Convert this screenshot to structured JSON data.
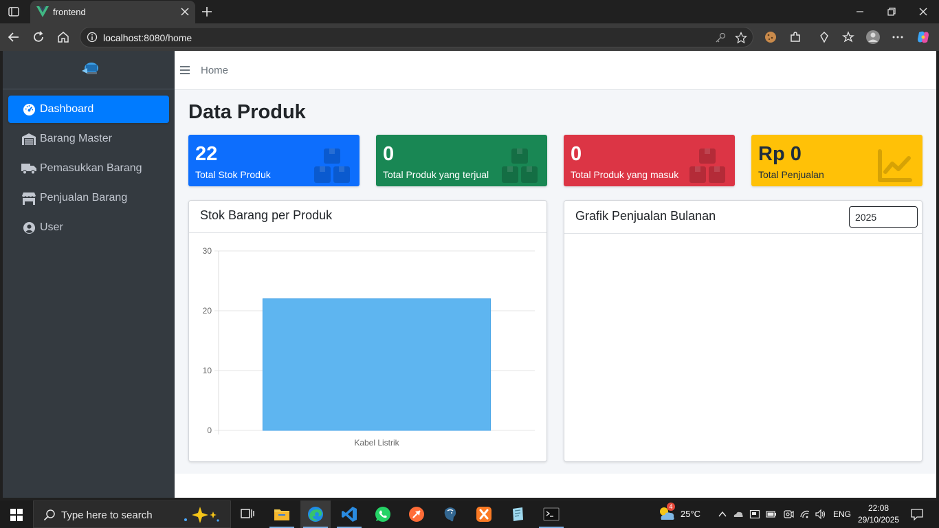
{
  "browser": {
    "tab_title": "frontend",
    "url_host": "localhost",
    "url_rest": ":8080/home"
  },
  "sidebar": {
    "items": [
      {
        "label": "Dashboard",
        "icon": "tachometer-icon",
        "active": true
      },
      {
        "label": "Barang Master",
        "icon": "warehouse-icon"
      },
      {
        "label": "Pemasukkan Barang",
        "icon": "truck-icon"
      },
      {
        "label": "Penjualan Barang",
        "icon": "store-icon"
      },
      {
        "label": "User",
        "icon": "user-circle-icon"
      }
    ]
  },
  "topnav": {
    "home_label": "Home"
  },
  "page": {
    "title": "Data Produk"
  },
  "stats": [
    {
      "value": "22",
      "label": "Total Stok Produk",
      "color": "#0d6efd",
      "icon": "boxes-icon"
    },
    {
      "value": "0",
      "label": "Total Produk yang terjual",
      "color": "#198754",
      "icon": "boxes-icon"
    },
    {
      "value": "0",
      "label": "Total Produk yang masuk",
      "color": "#dc3545",
      "icon": "boxes-icon"
    },
    {
      "value": "Rp 0",
      "label": "Total Penjualan",
      "color": "#ffc107",
      "icon": "chart-line-icon"
    }
  ],
  "cards": {
    "stock_title": "Stok Barang per Produk",
    "sales_title": "Grafik Penjualan Bulanan",
    "year_value": "2025"
  },
  "chart_data": {
    "type": "bar",
    "categories": [
      "Kabel Listrik"
    ],
    "values": [
      22
    ],
    "ylim": [
      0,
      30
    ],
    "yticks": [
      0,
      10,
      20,
      30
    ],
    "bar_color": "#5eb5f0",
    "grid": true,
    "title": "",
    "xlabel": "",
    "ylabel": ""
  },
  "taskbar": {
    "search_placeholder": "Type here to search",
    "weather": "25°C",
    "weather_badge": "4",
    "language": "ENG",
    "time": "22:08",
    "date": "29/10/2025"
  }
}
